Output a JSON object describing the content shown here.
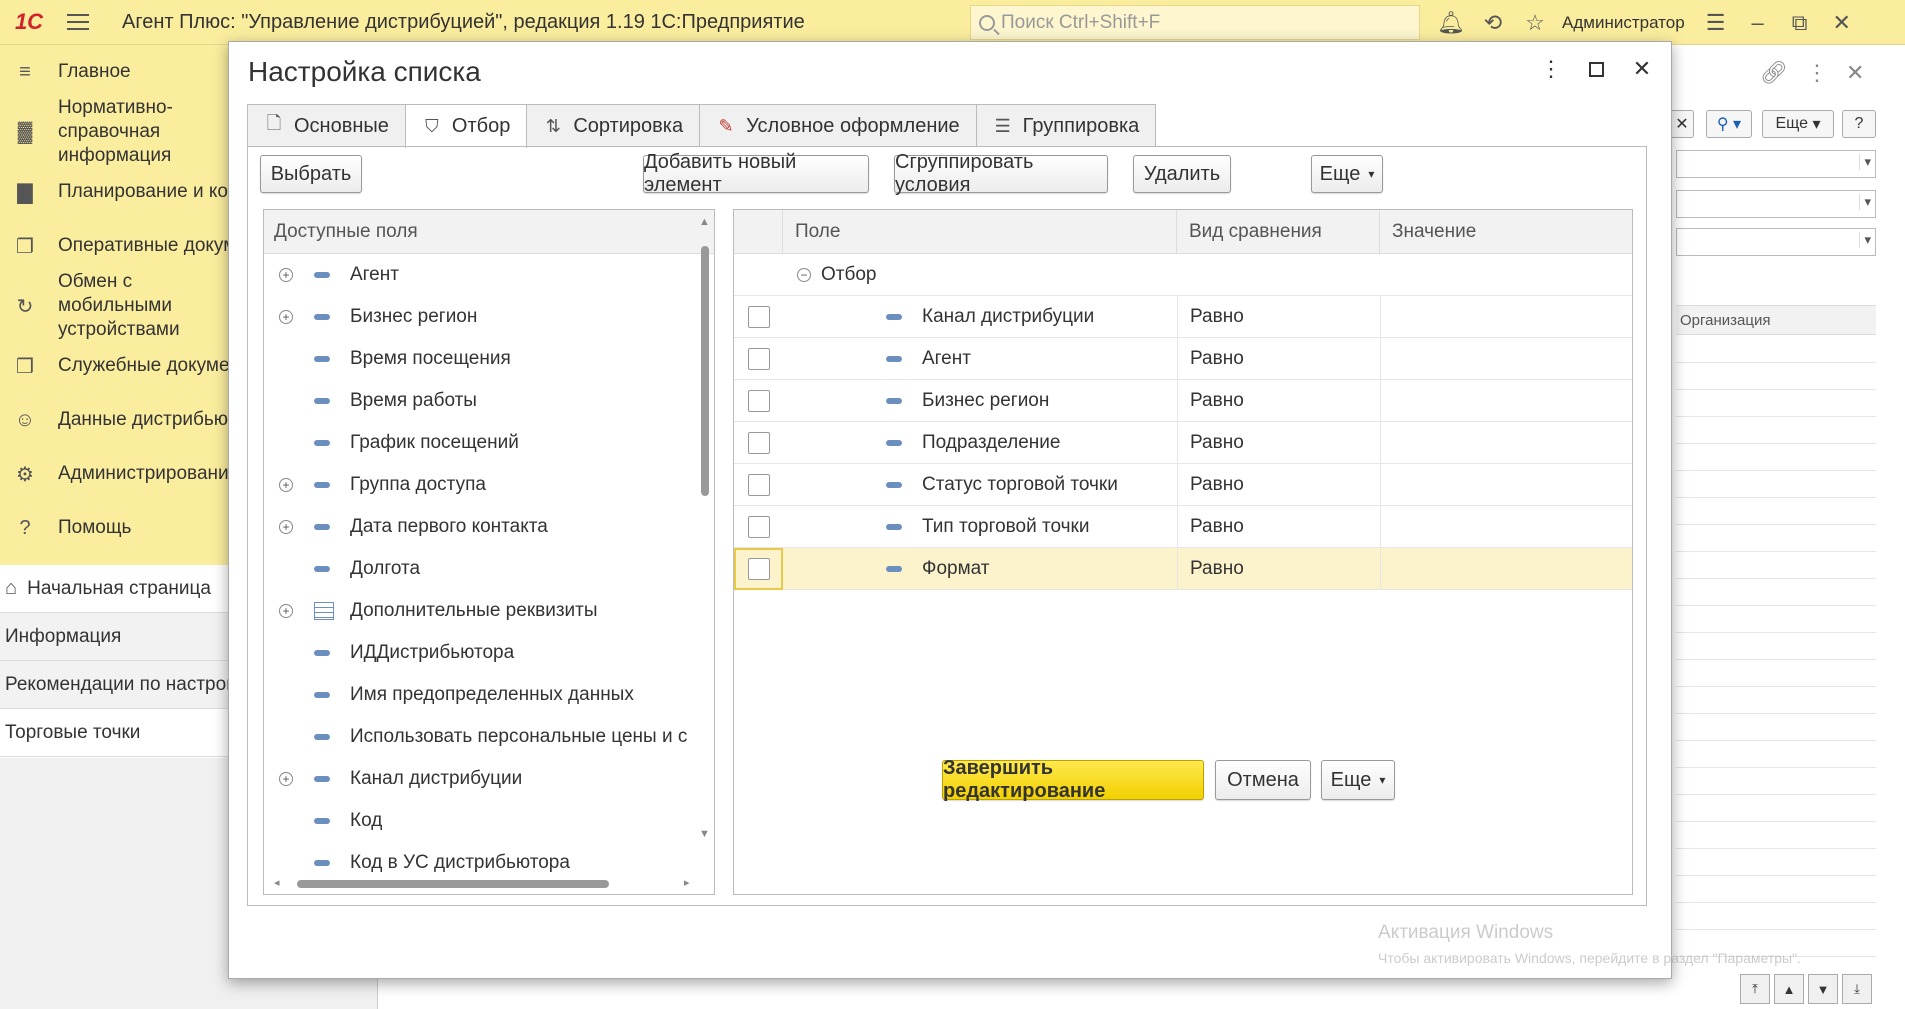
{
  "topbar": {
    "logo": "1C",
    "title": "Агент Плюс: \"Управление дистрибуцией\", редакция 1.19 1С:Предприятие",
    "search_placeholder": "Поиск Ctrl+Shift+F",
    "user": "Администратор"
  },
  "sidebar": {
    "items": [
      {
        "label": "Главное",
        "icon": "menu-icon"
      },
      {
        "label": "Нормативно-справочная информация",
        "icon": "books-icon"
      },
      {
        "label": "Планирование и контроль",
        "icon": "chart-icon"
      },
      {
        "label": "Оперативные документы",
        "icon": "documents-icon"
      },
      {
        "label": "Обмен с мобильными устройствами",
        "icon": "sync-icon"
      },
      {
        "label": "Служебные документы",
        "icon": "service-docs-icon"
      },
      {
        "label": "Данные дистрибьютора",
        "icon": "people-icon"
      },
      {
        "label": "Администрирование",
        "icon": "gear-icon"
      },
      {
        "label": "Помощь",
        "icon": "question-icon"
      }
    ]
  },
  "open_windows": [
    {
      "label": "Начальная страница"
    },
    {
      "label": "Информация"
    },
    {
      "label": "Рекомендации по настройке"
    },
    {
      "label": "Торговые точки"
    }
  ],
  "background_form": {
    "more_label": "Еще",
    "help_label": "?",
    "column_header": "Организация"
  },
  "dialog": {
    "title": "Настройка списка",
    "tabs": [
      {
        "label": "Основные",
        "icon": "document-icon"
      },
      {
        "label": "Отбор",
        "icon": "filter-icon"
      },
      {
        "label": "Сортировка",
        "icon": "sort-icon"
      },
      {
        "label": "Условное оформление",
        "icon": "brush-icon"
      },
      {
        "label": "Группировка",
        "icon": "group-icon"
      }
    ],
    "active_tab": "Отбор",
    "select_button": "Выбрать",
    "add_button": "Добавить новый элемент",
    "group_button": "Сгруппировать условия",
    "delete_button": "Удалить",
    "more_button": "Еще",
    "available_fields": {
      "header": "Доступные поля",
      "items": [
        {
          "label": "Агент",
          "expandable": true,
          "icon": "field"
        },
        {
          "label": "Бизнес регион",
          "expandable": true,
          "icon": "field"
        },
        {
          "label": "Время посещения",
          "expandable": false,
          "icon": "field"
        },
        {
          "label": "Время работы",
          "expandable": false,
          "icon": "field"
        },
        {
          "label": "График посещений",
          "expandable": false,
          "icon": "field"
        },
        {
          "label": "Группа доступа",
          "expandable": true,
          "icon": "field"
        },
        {
          "label": "Дата первого контакта",
          "expandable": true,
          "icon": "field"
        },
        {
          "label": "Долгота",
          "expandable": false,
          "icon": "field"
        },
        {
          "label": "Дополнительные реквизиты",
          "expandable": true,
          "icon": "table"
        },
        {
          "label": "ИДДистрибьютора",
          "expandable": false,
          "icon": "field"
        },
        {
          "label": "Имя предопределенных данных",
          "expandable": false,
          "icon": "field"
        },
        {
          "label": "Использовать персональные цены и с",
          "expandable": false,
          "icon": "field"
        },
        {
          "label": "Канал дистрибуции",
          "expandable": true,
          "icon": "field"
        },
        {
          "label": "Код",
          "expandable": false,
          "icon": "field"
        },
        {
          "label": "Код в УС дистрибьютора",
          "expandable": false,
          "icon": "field"
        }
      ]
    },
    "filter_table": {
      "columns": [
        "Поле",
        "Вид сравнения",
        "Значение"
      ],
      "group_label": "Отбор",
      "rows": [
        {
          "field": "Канал дистрибуции",
          "comparison": "Равно",
          "value": ""
        },
        {
          "field": "Агент",
          "comparison": "Равно",
          "value": ""
        },
        {
          "field": "Бизнес регион",
          "comparison": "Равно",
          "value": ""
        },
        {
          "field": "Подразделение",
          "comparison": "Равно",
          "value": ""
        },
        {
          "field": "Статус торговой точки",
          "comparison": "Равно",
          "value": ""
        },
        {
          "field": "Тип торговой точки",
          "comparison": "Равно",
          "value": ""
        },
        {
          "field": "Формат",
          "comparison": "Равно",
          "value": ""
        }
      ],
      "selected_row": "Формат"
    },
    "footer": {
      "finish_button": "Завершить редактирование",
      "cancel_button": "Отмена",
      "more_button": "Еще"
    }
  },
  "watermark": {
    "line1": "Активация Windows",
    "line2": "Чтобы активировать Windows, перейдите в раздел \"Параметры\"."
  }
}
